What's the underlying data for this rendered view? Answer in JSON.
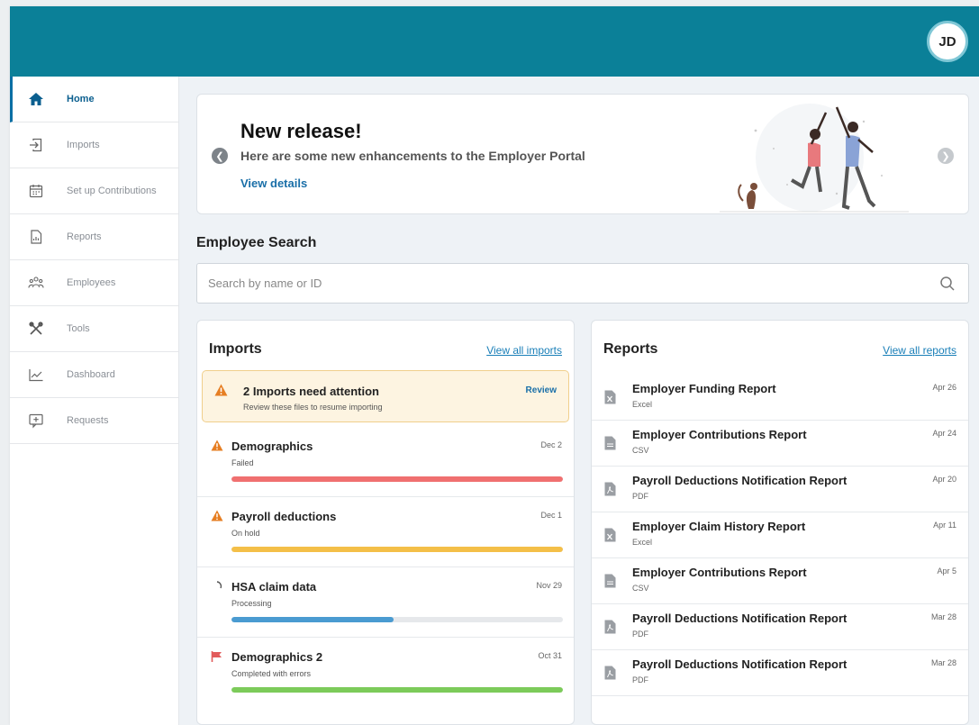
{
  "colors": {
    "brand": "#0b8098",
    "link": "#1a6fa8",
    "failed": "#f07070",
    "on_hold": "#f4bf48",
    "processing": "#4a9bd1",
    "completed": "#7ccb5a",
    "warning": "#e67e22"
  },
  "header": {
    "avatar_initials": "JD"
  },
  "sidebar": {
    "items": [
      {
        "label": "Home",
        "icon": "home-icon",
        "active": true
      },
      {
        "label": "Imports",
        "icon": "import-icon"
      },
      {
        "label": "Set up Contributions",
        "icon": "calendar-icon"
      },
      {
        "label": "Reports",
        "icon": "report-icon"
      },
      {
        "label": "Employees",
        "icon": "employees-icon"
      },
      {
        "label": "Tools",
        "icon": "tools-icon"
      },
      {
        "label": "Dashboard",
        "icon": "chart-icon"
      },
      {
        "label": "Requests",
        "icon": "request-icon"
      }
    ]
  },
  "banner": {
    "title": "New release!",
    "subtitle": "Here are some new enhancements to the Employer Portal",
    "link": "View details"
  },
  "search": {
    "title": "Employee Search",
    "placeholder": "Search by name or ID"
  },
  "imports": {
    "title": "Imports",
    "view_all": "View all imports",
    "alert": {
      "title": "2 Imports need attention",
      "subtitle": "Review these files to resume importing",
      "action": "Review"
    },
    "rows": [
      {
        "name": "Demographics",
        "status": "Failed",
        "date": "Dec 2",
        "progress": 1.0,
        "icon": "warning-icon"
      },
      {
        "name": "Payroll deductions",
        "status": "On hold",
        "date": "Dec 1",
        "progress": 1.0,
        "icon": "warning-icon"
      },
      {
        "name": "HSA claim data",
        "status": "Processing",
        "date": "Nov 29",
        "progress": 0.49,
        "icon": "spinner-icon"
      },
      {
        "name": "Demographics 2",
        "status": "Completed with errors",
        "date": "Oct 31",
        "progress": 1.0,
        "icon": "flag-icon"
      }
    ]
  },
  "reports": {
    "title": "Reports",
    "view_all": "View all reports",
    "rows": [
      {
        "name": "Employer Funding Report",
        "type": "Excel",
        "date": "Apr 26",
        "icon": "excel-file-icon"
      },
      {
        "name": "Employer Contributions Report",
        "type": "CSV",
        "date": "Apr 24",
        "icon": "csv-file-icon"
      },
      {
        "name": "Payroll Deductions Notification Report",
        "type": "PDF",
        "date": "Apr 20",
        "icon": "pdf-file-icon"
      },
      {
        "name": "Employer Claim History Report",
        "type": "Excel",
        "date": "Apr 11",
        "icon": "excel-file-icon"
      },
      {
        "name": "Employer Contributions Report",
        "type": "CSV",
        "date": "Apr 5",
        "icon": "csv-file-icon"
      },
      {
        "name": "Payroll Deductions Notification Report",
        "type": "PDF",
        "date": "Mar 28",
        "icon": "pdf-file-icon"
      },
      {
        "name": "Payroll Deductions Notification Report",
        "type": "PDF",
        "date": "Mar 28",
        "icon": "pdf-file-icon"
      }
    ]
  }
}
